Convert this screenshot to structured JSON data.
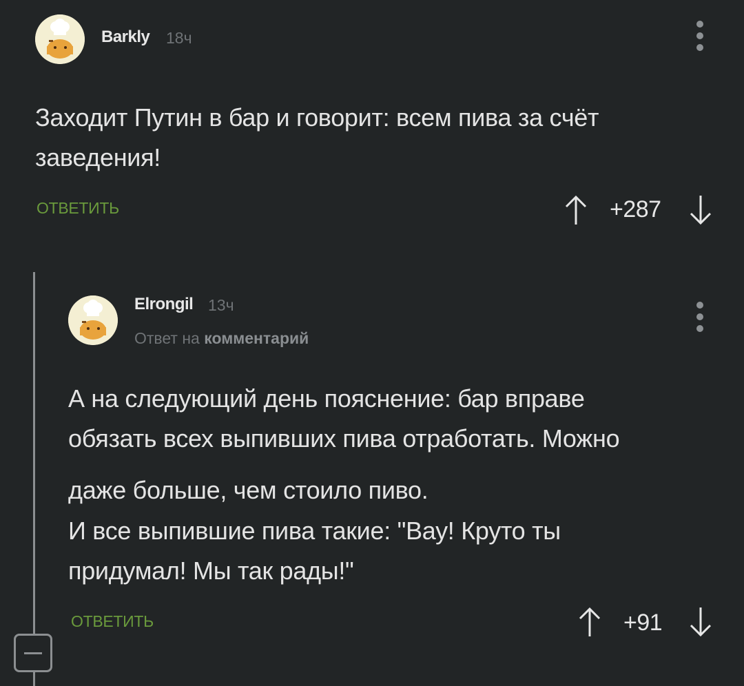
{
  "comments": [
    {
      "username": "Barkly",
      "time": "18ч",
      "text_lines": [
        "Заходит Путин в бар и говорит: всем пива за счёт",
        "заведения!"
      ],
      "reply_label": "ОТВЕТИТЬ",
      "score": "+287"
    },
    {
      "username": "Elrongil",
      "time": "13ч",
      "reply_to_prefix": "Ответ на",
      "reply_to_link": "комментарий",
      "text_lines": [
        "А на следующий день пояснение: бар вправе",
        "обязать всех выпивших пива отработать. Можно",
        "даже больше, чем стоило пиво.",
        "И все выпившие пива такие: \"Вау! Круто ты",
        "придумал! Мы так рады!\""
      ],
      "reply_label": "ОТВЕТИТЬ",
      "score": "+91"
    }
  ],
  "icons": {
    "avatar": "chef-hat-avatar-icon",
    "menu": "more-vertical-icon",
    "upvote": "arrow-up-icon",
    "downvote": "arrow-down-icon",
    "collapse": "minus-square-icon"
  },
  "colors": {
    "background": "#222526",
    "accent_green": "#6a9a3c",
    "muted_text": "#6f7376",
    "thread_line": "#8c8f91"
  }
}
